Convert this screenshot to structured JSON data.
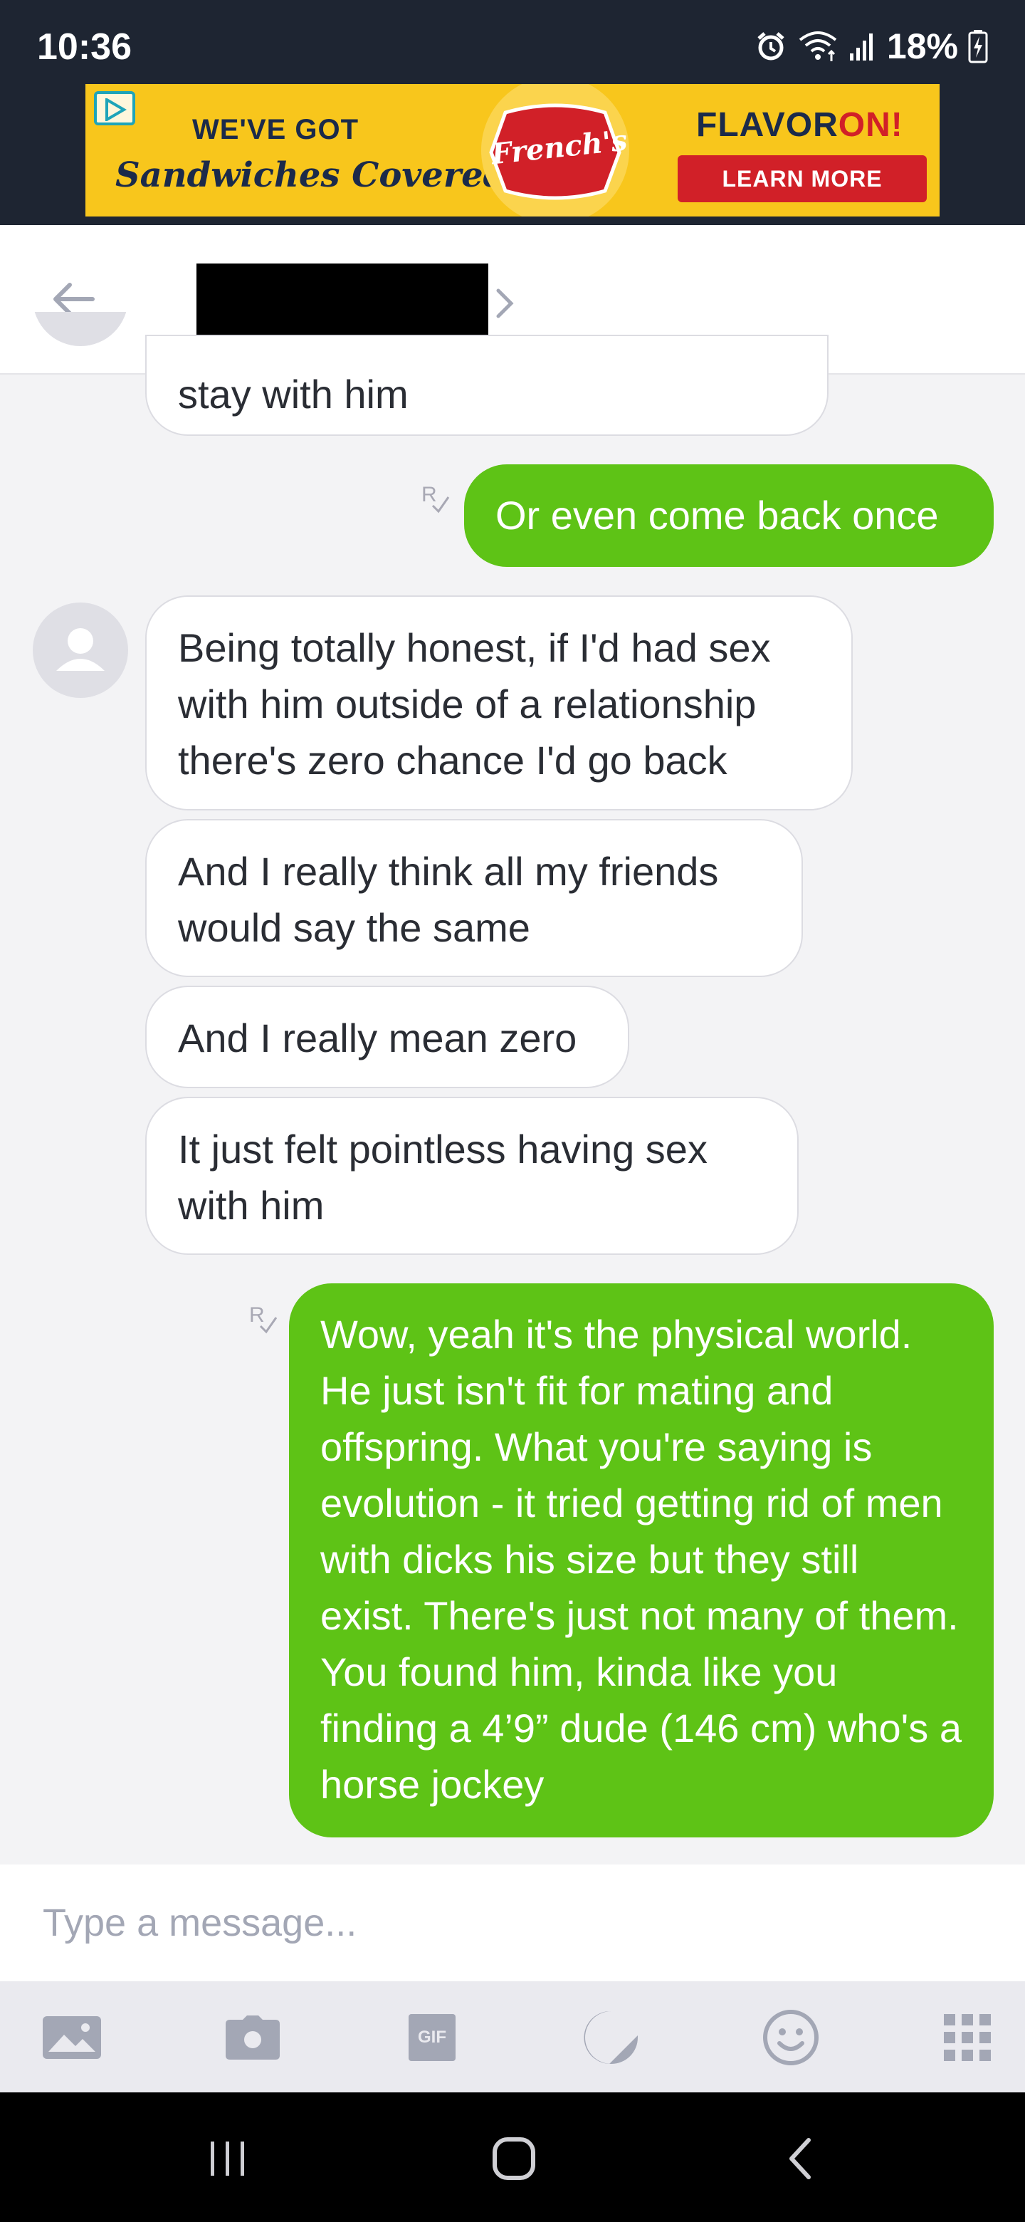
{
  "status_bar": {
    "time": "10:36",
    "battery": "18%"
  },
  "ad": {
    "left_line1": "WE'VE GOT",
    "left_line2": "Sandwiches Covered",
    "brand": "French's",
    "right_word1": "FLAVOR",
    "right_word2": "ON",
    "right_word3": "!",
    "cta": "LEARN MORE"
  },
  "header": {
    "contact_name": "[redacted]"
  },
  "messages": [
    {
      "side": "in",
      "text": "stay with him"
    },
    {
      "side": "out",
      "text": "Or even come back once",
      "receipt": "R"
    },
    {
      "side": "in",
      "text": "Being totally honest, if I'd had sex with him outside of a relationship there's zero chance I'd go back"
    },
    {
      "side": "in",
      "text": "And I really think all my friends would say the same"
    },
    {
      "side": "in",
      "text": "And I really mean zero"
    },
    {
      "side": "in",
      "text": "It just felt pointless having sex with him"
    },
    {
      "side": "out",
      "text": "Wow, yeah it's the physical world. He just isn't fit for mating and offspring. What you're saying is evolution - it tried getting rid of men with dicks his size but they still exist. There's just not many of them. You found him, kinda like you finding a 4’9” dude (146 cm) who's a horse jockey",
      "receipt": "R"
    }
  ],
  "composer": {
    "placeholder": "Type a message...",
    "gif_label": "GIF"
  },
  "colors": {
    "outgoing_bubble": "#5ec316",
    "status_bar": "#1e2532",
    "ad_background": "#f8c61c",
    "ad_cta": "#d12028"
  }
}
